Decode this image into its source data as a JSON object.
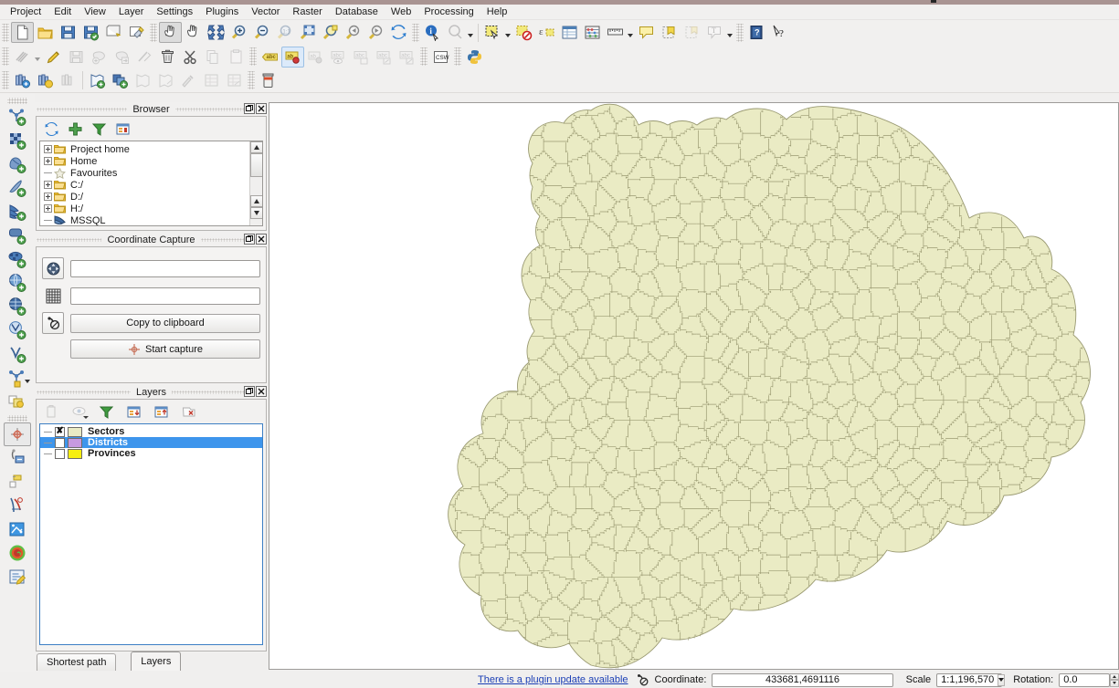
{
  "menu": {
    "items": [
      "Project",
      "Edit",
      "View",
      "Layer",
      "Settings",
      "Plugins",
      "Vector",
      "Raster",
      "Database",
      "Web",
      "Processing",
      "Help"
    ]
  },
  "toolbars": {
    "row1": [
      {
        "name": "new-project-icon",
        "label": "New Project"
      },
      {
        "name": "open-project-icon",
        "label": "Open Project"
      },
      {
        "name": "save-project-icon",
        "label": "Save Project"
      },
      {
        "name": "save-project-as-icon",
        "label": "Save Project As"
      },
      {
        "name": "new-print-layout-icon",
        "label": "New Print Layout"
      },
      {
        "name": "layout-manager-icon",
        "label": "Layout Manager"
      },
      {
        "name": "pan-map-icon",
        "label": "Pan Map"
      },
      {
        "name": "pan-hand-icon",
        "label": "Pan Map to Selection"
      },
      {
        "name": "zoom-full-icon",
        "label": "Zoom Full"
      },
      {
        "name": "zoom-in-icon",
        "label": "Zoom In"
      },
      {
        "name": "zoom-out-icon",
        "label": "Zoom Out"
      },
      {
        "name": "zoom-native-icon",
        "label": "Zoom to Native Resolution"
      },
      {
        "name": "zoom-to-selection-icon",
        "label": "Zoom to Selection"
      },
      {
        "name": "zoom-to-layer-icon",
        "label": "Zoom to Layer"
      },
      {
        "name": "zoom-last-icon",
        "label": "Zoom Last"
      },
      {
        "name": "zoom-next-icon",
        "label": "Zoom Next"
      },
      {
        "name": "refresh-icon",
        "label": "Refresh"
      },
      {
        "name": "identify-features-icon",
        "label": "Identify Features"
      },
      {
        "name": "map-tips-icon",
        "label": "Show Map Tips"
      },
      {
        "name": "select-features-icon",
        "label": "Select Features"
      },
      {
        "name": "deselect-features-icon",
        "label": "Deselect Features"
      },
      {
        "name": "select-by-expression-icon",
        "label": "Select by Expression"
      },
      {
        "name": "open-attribute-table-icon",
        "label": "Open Attribute Table"
      },
      {
        "name": "field-calculator-icon",
        "label": "Open Field Calculator"
      },
      {
        "name": "measure-line-icon",
        "label": "Measure Line"
      },
      {
        "name": "annotation-icon",
        "label": "Text Annotation"
      },
      {
        "name": "new-bookmark-icon",
        "label": "New Spatial Bookmark"
      },
      {
        "name": "show-bookmarks-icon",
        "label": "Show Bookmarks"
      },
      {
        "name": "text-annotation-icon",
        "label": "Annotations"
      },
      {
        "name": "help-icon",
        "label": "Help Contents"
      },
      {
        "name": "whats-this-icon",
        "label": "What's This?"
      }
    ],
    "row2": [
      {
        "name": "current-edits-icon",
        "label": "Current Edits"
      },
      {
        "name": "toggle-editing-icon",
        "label": "Toggle Editing"
      },
      {
        "name": "save-layer-edits-icon",
        "label": "Save Layer Edits"
      },
      {
        "name": "add-feature-icon",
        "label": "Add Feature"
      },
      {
        "name": "move-feature-icon",
        "label": "Move Feature"
      },
      {
        "name": "node-tool-icon",
        "label": "Vertex Tool"
      },
      {
        "name": "delete-selected-icon",
        "label": "Delete Selected"
      },
      {
        "name": "cut-features-icon",
        "label": "Cut Features"
      },
      {
        "name": "copy-features-icon",
        "label": "Copy Features"
      },
      {
        "name": "paste-features-icon",
        "label": "Paste Features"
      },
      {
        "name": "label-icon",
        "label": "Layer Labeling Options"
      },
      {
        "name": "highlight-pinned-labels-icon",
        "label": "Highlight Pinned Labels"
      },
      {
        "name": "pin-labels-icon",
        "label": "Pin/Unpin Labels"
      },
      {
        "name": "show-hide-labels-icon",
        "label": "Show/Hide Labels"
      },
      {
        "name": "move-label-icon",
        "label": "Move Label"
      },
      {
        "name": "rotate-label-icon",
        "label": "Rotate Label"
      },
      {
        "name": "change-label-icon",
        "label": "Change Label"
      },
      {
        "name": "metasearch-csw-icon",
        "label": "MetaSearch"
      },
      {
        "name": "python-console-icon",
        "label": "Python Console"
      }
    ],
    "row3": [
      {
        "name": "data-source-manager-icon",
        "label": "Data Source Manager"
      },
      {
        "name": "add-vector-layer-icon",
        "label": "Add Vector Layer"
      },
      {
        "name": "add-raster-layer-icon",
        "label": "Add Raster Layer"
      },
      {
        "name": "new-shapefile-layer-icon",
        "label": "New Shapefile Layer"
      },
      {
        "name": "new-geopackage-layer-icon",
        "label": "New GeoPackage Layer"
      },
      {
        "name": "new-spatialite-layer-icon",
        "label": "New SpatiaLite Layer"
      },
      {
        "name": "new-memory-layer-icon",
        "label": "New Temporary Scratch Layer"
      },
      {
        "name": "georeferencer-icon",
        "label": "Georeferencer"
      },
      {
        "name": "open-table-icon",
        "label": "Open Table"
      },
      {
        "name": "edit-table-icon",
        "label": "Edit Table"
      },
      {
        "name": "db-manager-icon",
        "label": "DB Manager"
      }
    ],
    "vertical": [
      {
        "name": "add-vector-layer-icon",
        "label": "Add Vector Layer"
      },
      {
        "name": "add-raster-layer-icon",
        "label": "Add Raster Layer"
      },
      {
        "name": "add-mesh-layer-icon",
        "label": "Add Mesh Layer"
      },
      {
        "name": "add-delimited-text-layer-icon",
        "label": "Add Delimited Text Layer"
      },
      {
        "name": "add-postgis-layer-icon",
        "label": "Add PostGIS Layer"
      },
      {
        "name": "add-spatialite-layer-icon",
        "label": "Add SpatiaLite Layer"
      },
      {
        "name": "add-mssql-layer-icon",
        "label": "Add MSSQL Spatial Layer"
      },
      {
        "name": "add-wms-layer-icon",
        "label": "Add WMS/WMTS Layer"
      },
      {
        "name": "add-wcs-layer-icon",
        "label": "Add WCS Layer"
      },
      {
        "name": "add-wfs-layer-icon",
        "label": "Add WFS Layer"
      },
      {
        "name": "add-virtual-layer-icon",
        "label": "Add Virtual Layer"
      },
      {
        "name": "add-arcgis-layer-icon",
        "label": "Add ArcGIS Server Layer"
      },
      {
        "name": "style-manager-icon",
        "label": "Style Manager"
      },
      {
        "name": "coordinate-capture-icon",
        "label": "Coordinate Capture"
      },
      {
        "name": "geometry-checker-icon",
        "label": "Geometry Checker"
      },
      {
        "name": "topology-checker-icon",
        "label": "Topology Checker"
      },
      {
        "name": "road-graph-icon",
        "label": "Road Graph"
      },
      {
        "name": "offline-editing-icon",
        "label": "Offline Editing"
      },
      {
        "name": "heatmap-icon",
        "label": "Heatmap"
      },
      {
        "name": "processing-toolbox-icon",
        "label": "Processing Toolbox"
      }
    ]
  },
  "browser": {
    "title": "Browser",
    "toolbar": [
      {
        "name": "refresh-icon",
        "label": "Refresh"
      },
      {
        "name": "add-selected-layers-icon",
        "label": "Add Selected Layers"
      },
      {
        "name": "filter-browser-icon",
        "label": "Filter Browser"
      },
      {
        "name": "collapse-all-icon",
        "label": "Collapse All"
      }
    ],
    "tree": [
      {
        "label": "Project home",
        "icon": "folder-icon",
        "expandable": true
      },
      {
        "label": "Home",
        "icon": "folder-icon",
        "expandable": true
      },
      {
        "label": "Favourites",
        "icon": "star-icon",
        "expandable": false
      },
      {
        "label": "C:/",
        "icon": "folder-icon",
        "expandable": true
      },
      {
        "label": "D:/",
        "icon": "folder-icon",
        "expandable": true
      },
      {
        "label": "H:/",
        "icon": "folder-icon",
        "expandable": true
      },
      {
        "label": "MSSQL",
        "icon": "mssql-icon",
        "expandable": false
      }
    ]
  },
  "coordinate_capture": {
    "title": "Coordinate Capture",
    "field1_value": "",
    "field2_value": "",
    "field1_placeholder": "",
    "field2_placeholder": "",
    "copy_label": "Copy to clipboard",
    "capture_label": "Start capture",
    "icons": [
      {
        "name": "crs-choose-icon",
        "label": "Click to select the CRS to use for coordinate display"
      },
      {
        "name": "canvas-coordinate-icon",
        "label": "Canvas coordinate"
      },
      {
        "name": "copy-icon",
        "label": "Copy to clipboard"
      }
    ]
  },
  "layers_panel": {
    "title": "Layers",
    "toolbar": [
      {
        "name": "open-layer-styling-icon",
        "label": "Open the Layer Styling panel"
      },
      {
        "name": "manage-visibility-icon",
        "label": "Manage Map Themes"
      },
      {
        "name": "filter-legend-icon",
        "label": "Filter Legend"
      },
      {
        "name": "expand-all-icon",
        "label": "Expand All"
      },
      {
        "name": "collapse-all-icon",
        "label": "Collapse All"
      },
      {
        "name": "remove-layer-icon",
        "label": "Remove Layer/Group"
      }
    ],
    "layers": [
      {
        "name": "Sectors",
        "checked": true,
        "selected": false,
        "color": "#eaebc4"
      },
      {
        "name": "Districts",
        "checked": false,
        "selected": true,
        "color": "#c79ae0"
      },
      {
        "name": "Provinces",
        "checked": false,
        "selected": false,
        "color": "#f6ef10"
      }
    ]
  },
  "bottom_tabs": [
    {
      "label": "Shortest path",
      "selected": false
    },
    {
      "label": "Layers",
      "selected": true
    }
  ],
  "statusbar": {
    "plugin_message": "There is a plugin update available",
    "message_icon": "messages-icon",
    "coordinate_label": "Coordinate:",
    "coordinate_value": "433681,4691116",
    "scale_label": "Scale",
    "scale_value": "1:1,196,570",
    "rotation_label": "Rotation:",
    "rotation_value": "0.0"
  },
  "map": {
    "background": "#ffffff",
    "fill": "#eaebc4",
    "stroke": "#9a9a72",
    "layer_rendered": "Sectors"
  },
  "colors": {
    "chrome": "#f1f0ef",
    "title_bar": "#a99492",
    "selection_blue": "#3d95ec",
    "link_blue": "#1b3fb5"
  }
}
